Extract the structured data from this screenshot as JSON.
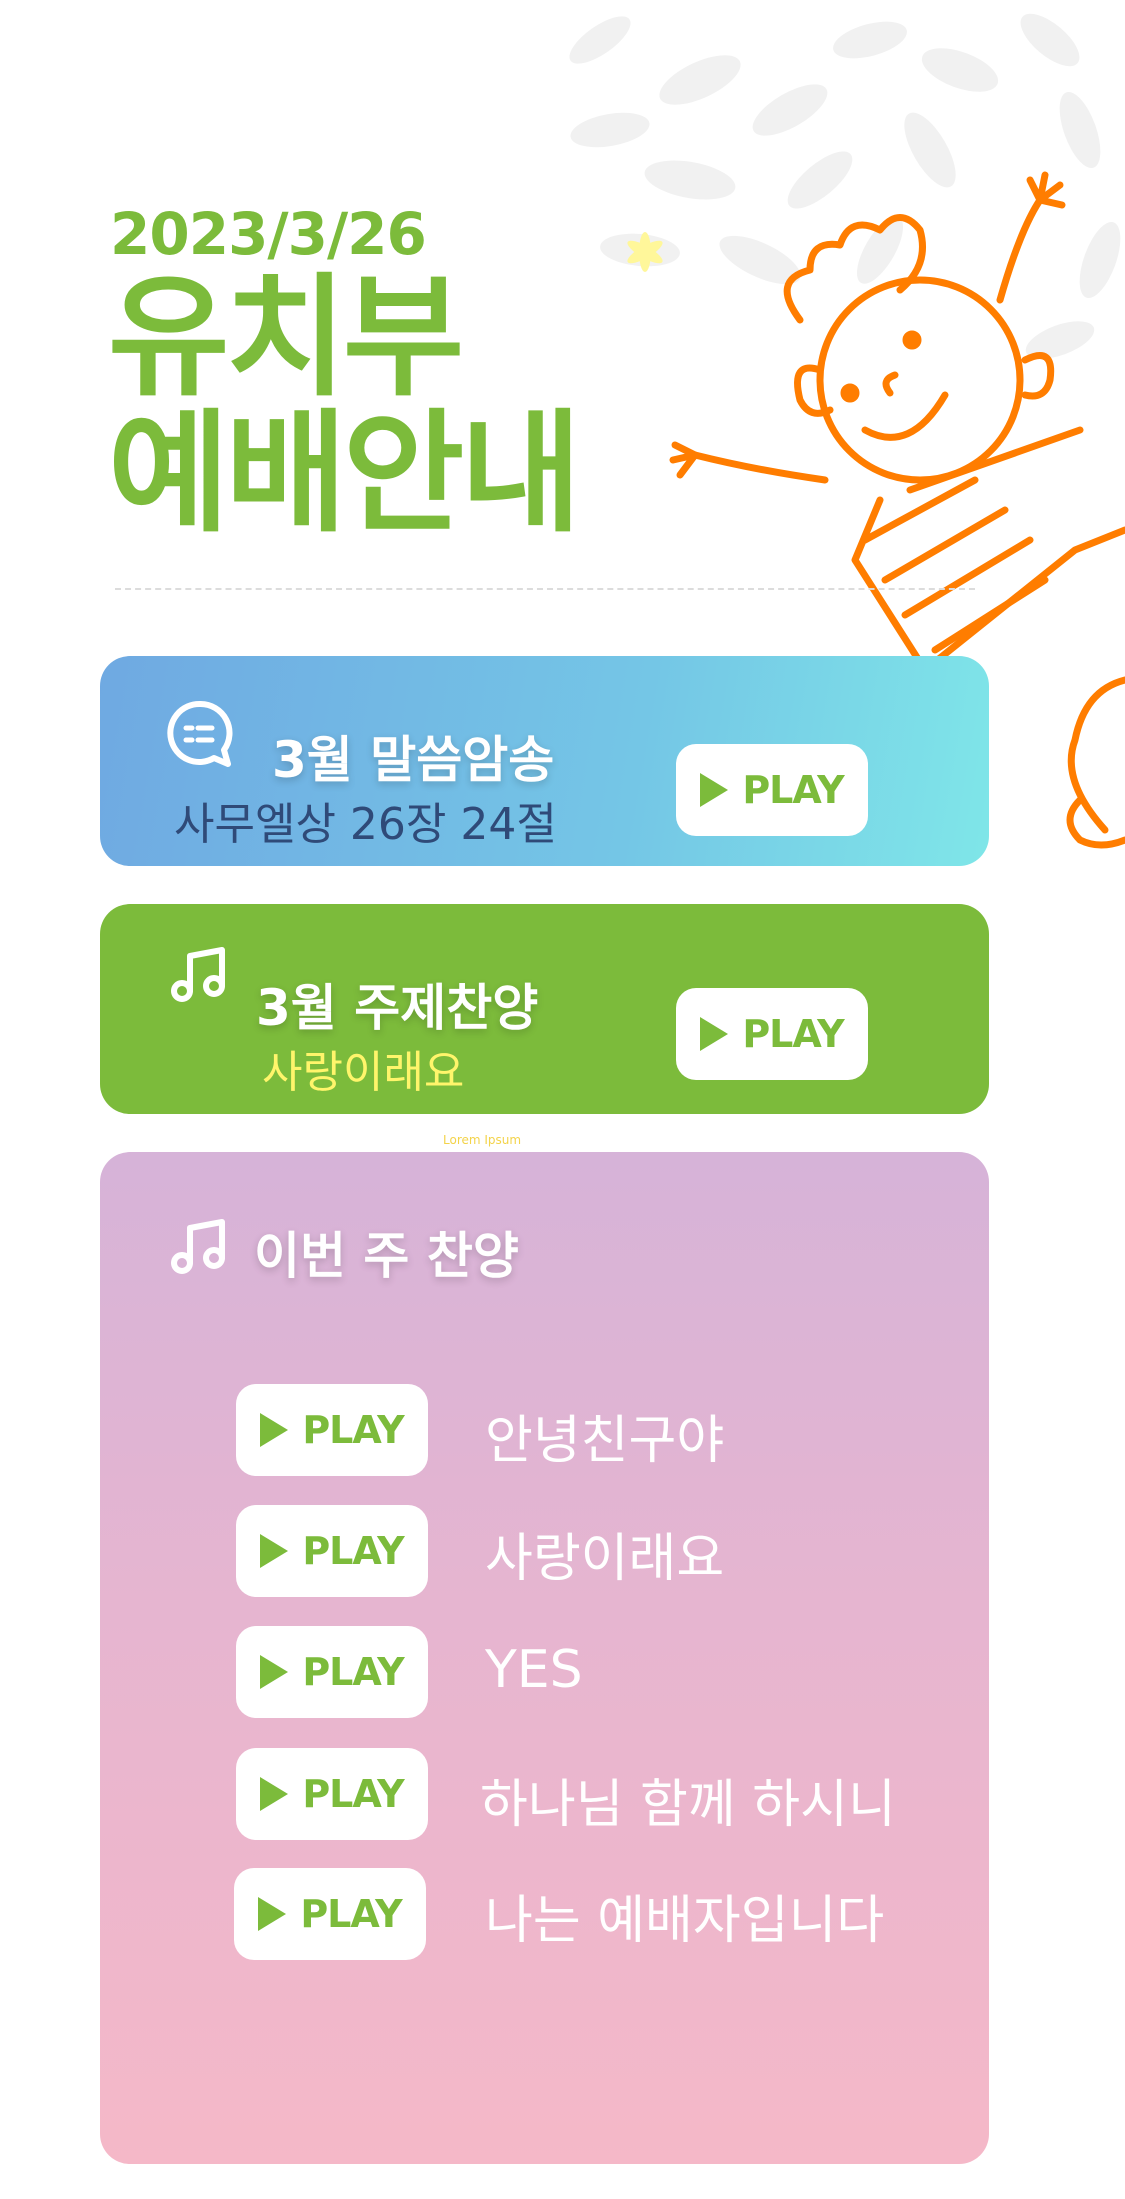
{
  "header": {
    "date": "2023/3/26",
    "title_line1": "유치부",
    "title_line2": "예배안내"
  },
  "colors": {
    "brand_green": "#7cbb3b",
    "accent_yellow": "#fff56b",
    "verse_text": "#2f4a78",
    "character_orange": "#ff7d00"
  },
  "memory_verse": {
    "icon": "speech-bubble-icon",
    "title": "3월 말씀암송",
    "reference": "사무엘상 26장 24절",
    "play_label": "PLAY"
  },
  "theme_song": {
    "icon": "music-note-icon",
    "title": "3월 주제찬양",
    "song": "사랑이래요",
    "play_label": "PLAY"
  },
  "tiny_label": "Lorem Ipsum",
  "weekly_songs": {
    "icon": "music-note-icon",
    "title": "이번 주 찬양",
    "items": [
      {
        "play_label": "PLAY",
        "title": "안녕친구야"
      },
      {
        "play_label": "PLAY",
        "title": "사랑이래요"
      },
      {
        "play_label": "PLAY",
        "title": "YES"
      },
      {
        "play_label": "PLAY",
        "title": "하나님 함께 하시니"
      },
      {
        "play_label": "PLAY",
        "title": "나는 예배자입니다"
      }
    ]
  }
}
